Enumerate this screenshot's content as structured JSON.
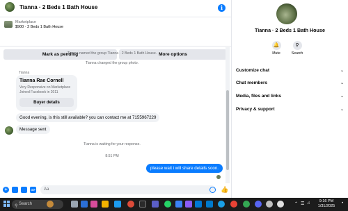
{
  "header": {
    "title": "Tianna · 2 Beds 1 Bath House",
    "info_icon": "info-icon"
  },
  "listing": {
    "label": "Marketplace",
    "price_title": "$900 · 2 Beds 1 Bath House",
    "mark_pending": "Mark as pending",
    "more_options": "More options"
  },
  "messages": {
    "sys_named": "Tianna named the group Tianna · 2 Beds 1 Bath House.",
    "sys_photo": "Tianna changed the group photo.",
    "sender_name": "Tianna",
    "card_name": "Tianna Rae Cornell",
    "card_line1": "Very Responsive on Marketplace",
    "card_line2": "Joined Facebook in 2011",
    "buyer_details": "Buyer details",
    "msg_available": "Good evening, is this still available? you can contact me at 7155967229",
    "msg_sent": "Message sent",
    "sys_waiting": "Tianna is waiting for your response.",
    "time": "8:51 PM",
    "msg_reply": "please wait i will share details soon."
  },
  "composer": {
    "placeholder": "Aa",
    "icons": [
      "plus-icon",
      "photo-icon",
      "sticker-icon",
      "gif-icon"
    ]
  },
  "info_panel": {
    "title": "Tianna · 2 Beds 1 Bath House",
    "mute": "Mute",
    "search": "Search",
    "rows": [
      "Customize chat",
      "Chat members",
      "Media, files and links",
      "Privacy & support"
    ]
  },
  "taskbar": {
    "search": "Search",
    "time": "9:16 PM",
    "date": "1/31/2025"
  },
  "colors": {
    "accent": "#0a7cff",
    "bubble_in": "#f0f2f5",
    "taskbar": "#1c1c1c"
  }
}
